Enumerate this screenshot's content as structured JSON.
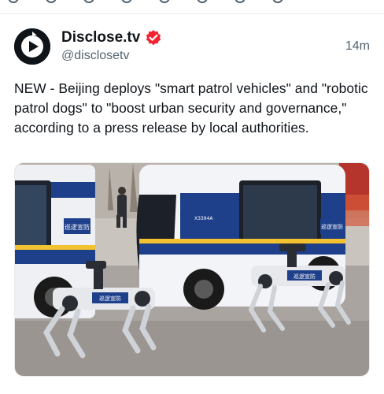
{
  "author": {
    "display_name": "Disclose.tv",
    "handle": "@disclosetv",
    "verified": true,
    "avatar_icon": "play-logo-icon"
  },
  "post": {
    "timestamp": "14m",
    "text": "NEW - Beijing deploys \"smart patrol vehicles\" and \"robotic patrol dogs\" to \"boost urban security and governance,\" according to a press release by local authorities."
  },
  "media": {
    "vehicle_sign": "巡逻宣防",
    "robot_label": "巡逻宣防",
    "plate_text": "X3394A"
  },
  "colors": {
    "text": "#0f1419",
    "secondary": "#536471",
    "verified_badge": "#f4212e",
    "vehicle_blue": "#1e3f8a"
  }
}
